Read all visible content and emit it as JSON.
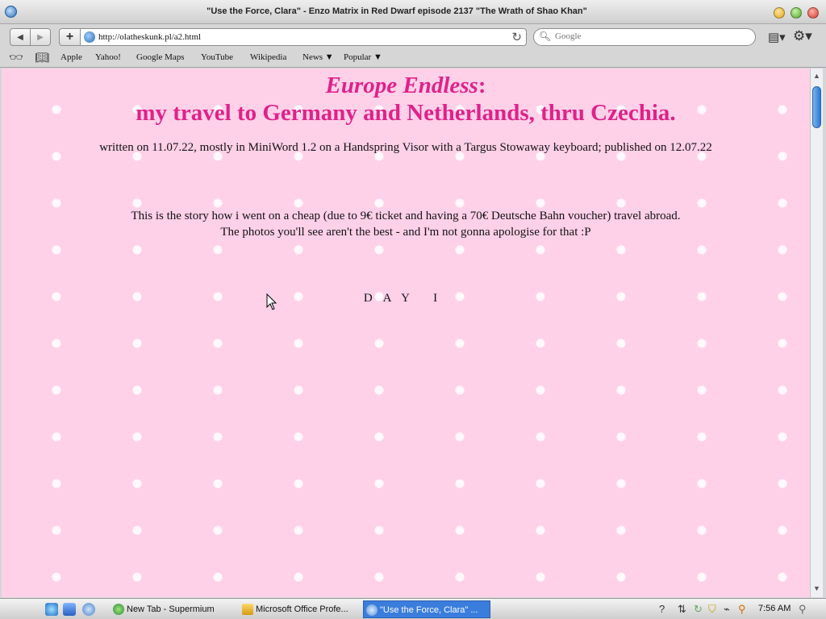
{
  "window": {
    "title": "\"Use the Force, Clara\" - Enzo Matrix in Red Dwarf episode 2137 \"The Wrath of Shao Khan\""
  },
  "toolbar": {
    "back_icon": "back-arrow-icon",
    "forward_icon": "forward-arrow-icon",
    "add_icon": "plus-icon",
    "url": "http://olatheskunk.pl/a2.html",
    "search_placeholder": "Google"
  },
  "bookmarks": {
    "items": [
      {
        "label": "Apple"
      },
      {
        "label": "Yahoo!"
      },
      {
        "label": "Google Maps"
      },
      {
        "label": "YouTube"
      },
      {
        "label": "Wikipedia"
      },
      {
        "label": "News ▼"
      },
      {
        "label": "Popular ▼"
      }
    ]
  },
  "page": {
    "title_italic": "Europe Endless",
    "title_colon": ":",
    "title_line2": "my travel to Germany and Netherlands, thru Czechia.",
    "byline": "written on 11.07.22, mostly in MiniWord 1.2 on a Handspring Visor with a Targus Stowaway keyboard; published on 12.07.22",
    "intro_line1": "This is the story how i went on a cheap (due to 9€ ticket and having a 70€ Deutsche Bahn voucher) travel abroad.",
    "intro_line2": "The photos you'll see aren't the best - and I'm not gonna apologise for that :P",
    "day_heading": "DAY I",
    "accent_color": "#e0218a",
    "background_color": "#ffd1e8"
  },
  "taskbar": {
    "tasks": [
      {
        "label": "New Tab - Supermium"
      },
      {
        "label": "Microsoft Office Profe..."
      },
      {
        "label": "\"Use the Force, Clara\" ..."
      }
    ],
    "clock": "7:56 AM"
  }
}
